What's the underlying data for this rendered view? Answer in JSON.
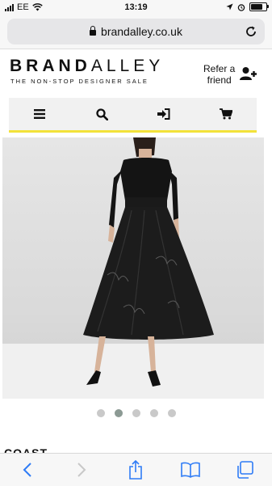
{
  "status_bar": {
    "carrier": "EE",
    "time": "13:19",
    "battery_level": 0.85
  },
  "browser": {
    "url": "brandalley.co.uk"
  },
  "header": {
    "logo_part1": "BRAND",
    "logo_part2": "ALLEY",
    "tagline": "THE NON-STOP DESIGNER SALE",
    "refer_line1": "Refer a",
    "refer_line2": "friend"
  },
  "nav": {
    "items": [
      {
        "icon": "menu-icon"
      },
      {
        "icon": "search-icon"
      },
      {
        "icon": "sign-in-icon"
      },
      {
        "icon": "cart-icon"
      }
    ]
  },
  "carousel": {
    "count": 5,
    "active_index": 1
  },
  "product": {
    "brand": "COAST"
  },
  "colors": {
    "accent": "#f3e23a",
    "ios_blue": "#2f7cf6"
  }
}
